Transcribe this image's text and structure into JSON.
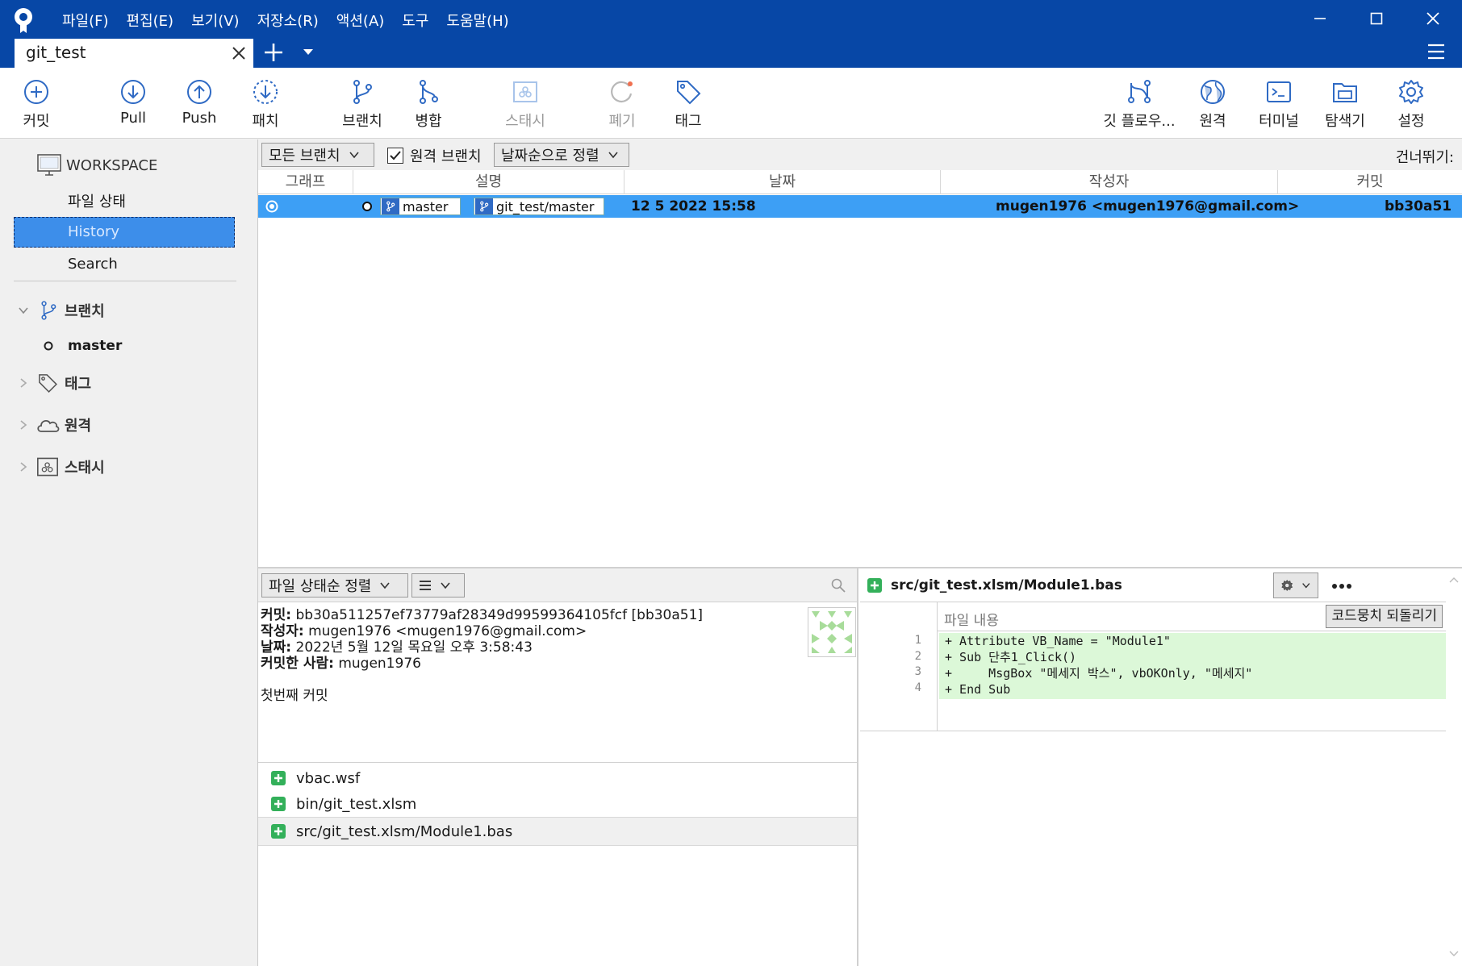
{
  "window": {
    "tab_title": "git_test",
    "menu": [
      "파일(F)",
      "편집(E)",
      "보기(V)",
      "저장소(R)",
      "액션(A)",
      "도구",
      "도움말(H)"
    ]
  },
  "toolbar": {
    "commit": "커밋",
    "pull": "Pull",
    "push": "Push",
    "patch": "패치",
    "branch": "브랜치",
    "merge": "병합",
    "stash": "스태시",
    "discard": "폐기",
    "tag": "태그",
    "gitflow": "깃 플로우...",
    "remote": "원격",
    "terminal": "터미널",
    "explorer": "탐색기",
    "settings": "설정"
  },
  "sidebar": {
    "workspace": "WORKSPACE",
    "file_status": "파일 상태",
    "history": "History",
    "search": "Search",
    "branches": "브랜치",
    "branch_master": "master",
    "tags": "태그",
    "remotes": "원격",
    "stashes": "스태시"
  },
  "filter": {
    "branches": "모든 브랜치",
    "remote_branches": "원격 브랜치",
    "remote_checked": true,
    "sort": "날짜순으로 정렬",
    "jump": "건너뛰기:"
  },
  "columns": {
    "graph": "그래프",
    "description": "설명",
    "date": "날짜",
    "author": "작성자",
    "commit": "커밋"
  },
  "commit_row": {
    "local_ref": "master",
    "remote_ref": "git_test/master",
    "date": "12 5 2022 15:58",
    "author": "mugen1976 <mugen1976@gmail.com>",
    "hash": "bb30a51"
  },
  "details": {
    "sort": "파일 상태순 정렬",
    "commit_label": "커밋:",
    "commit_value": "bb30a511257ef73779af28349d99599364105fcf [bb30a51]",
    "author_label": "작성자:",
    "author_value": "mugen1976 <mugen1976@gmail.com>",
    "date_label": "날짜:",
    "date_value": "2022년 5월 12일 목요일 오후 3:58:43",
    "committer_label": "커밋한 사람:",
    "committer_value": "mugen1976",
    "message": "첫번째 커밋"
  },
  "files": [
    "vbac.wsf",
    "bin/git_test.xlsm",
    "src/git_test.xlsm/Module1.bas"
  ],
  "diff": {
    "path": "src/git_test.xlsm/Module1.bas",
    "file_content": "파일 내용",
    "revert_hunk": "코드뭉치 되돌리기",
    "line_numbers": [
      "1",
      "2",
      "3",
      "4"
    ],
    "lines": [
      "+ Attribute VB_Name = \"Module1\"",
      "+ Sub 단추1_Click()",
      "+     MsgBox \"메세지 박스\", vbOKOnly, \"메세지\"",
      "+ End Sub"
    ]
  }
}
